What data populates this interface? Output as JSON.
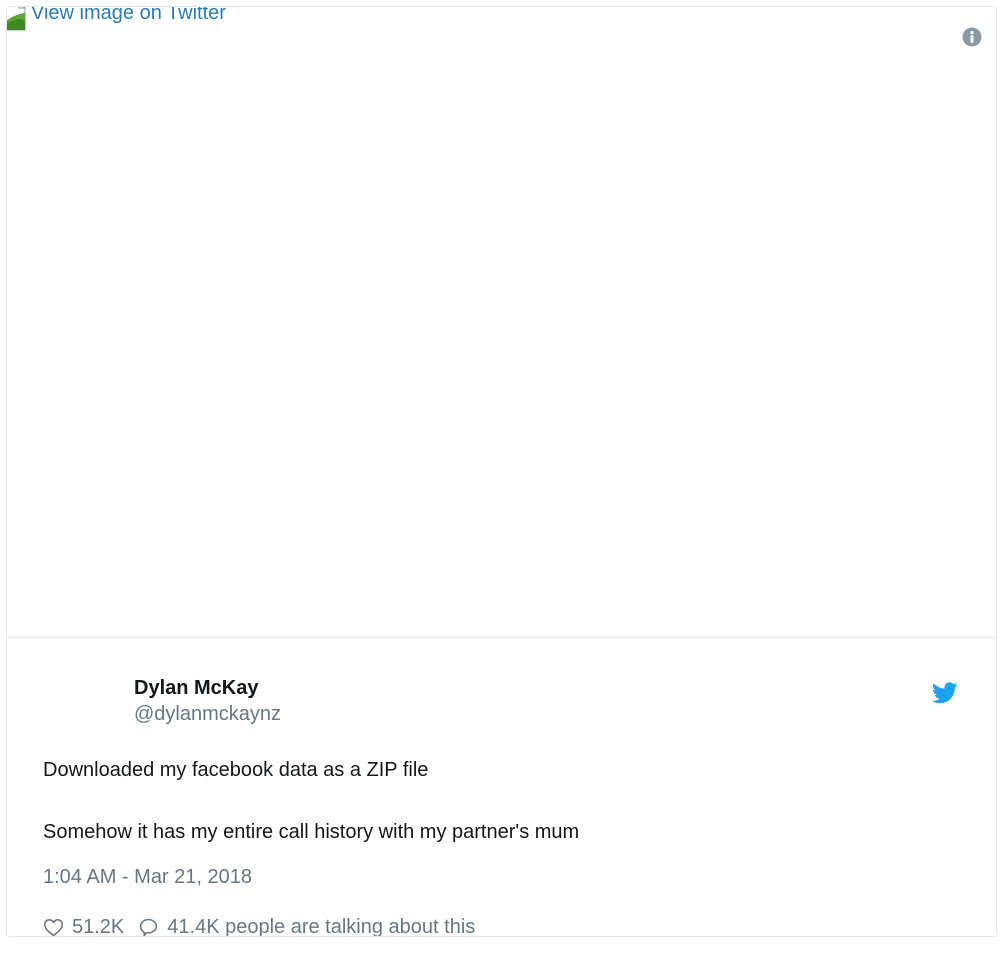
{
  "media": {
    "link_text": "View image on Twitter"
  },
  "author": {
    "name": "Dylan McKay",
    "handle": "@dylanmckaynz"
  },
  "tweet": {
    "line1": "Downloaded my facebook data as a ZIP file",
    "line2": "Somehow it has my entire call history with my partner's mum",
    "timestamp": "1:04 AM - Mar 21, 2018"
  },
  "actions": {
    "likes": "51.2K",
    "talking": "41.4K people are talking about this"
  },
  "icons": {
    "info": "info-icon",
    "twitter": "twitter-bird-icon",
    "like": "heart-icon",
    "reply": "speech-bubble-icon",
    "broken_image": "broken-image-icon"
  },
  "colors": {
    "link": "#2b7bb9",
    "twitter_blue": "#1da1f2",
    "text": "#14171a",
    "muted": "#657786",
    "border": "#e1e8ed"
  }
}
